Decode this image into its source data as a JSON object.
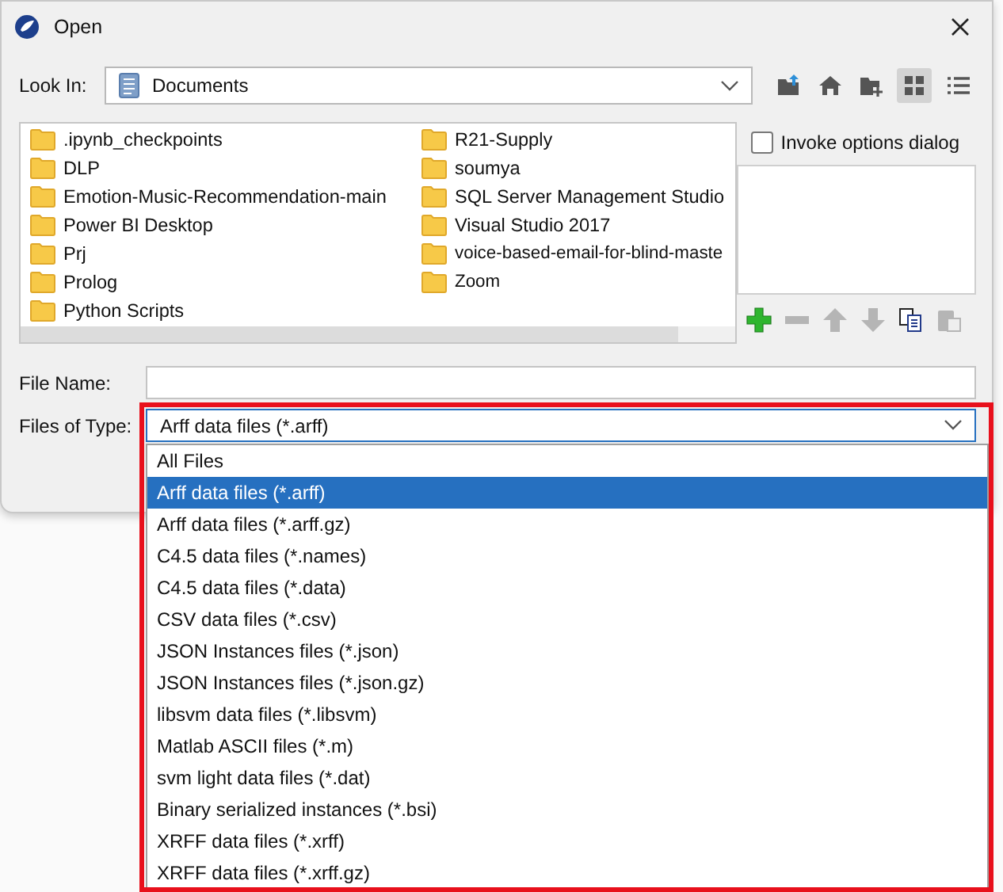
{
  "window": {
    "title": "Open"
  },
  "look_in": {
    "label": "Look In:",
    "value": "Documents"
  },
  "view_modes": [
    {
      "kind": "list",
      "selected": true
    },
    {
      "kind": "details",
      "selected": false
    }
  ],
  "folders": [
    ".ipynb_checkpoints",
    "DLP",
    "Emotion-Music-Recommendation-main",
    "Power BI Desktop",
    "Prj",
    "Prolog",
    "Python Scripts",
    "R21-Supply",
    "soumya",
    "SQL Server Management Studio",
    "Visual Studio 2017",
    "voice-based-email-for-blind-maste",
    "Zoom"
  ],
  "invoke_options": {
    "label": "Invoke options dialog",
    "checked": false
  },
  "option_buttons": [
    {
      "kind": "add",
      "disabled": false
    },
    {
      "kind": "remove",
      "disabled": true
    },
    {
      "kind": "up",
      "disabled": true
    },
    {
      "kind": "down",
      "disabled": true
    },
    {
      "kind": "copy",
      "disabled": false
    },
    {
      "kind": "paste",
      "disabled": true
    }
  ],
  "file_name": {
    "label": "File Name:"
  },
  "files_of_type": {
    "label": "Files of Type:",
    "value": "Arff data files (*.arff)",
    "expanded": true,
    "options": [
      {
        "label": "All Files",
        "selected": false
      },
      {
        "label": "Arff data files (*.arff)",
        "selected": true
      },
      {
        "label": "Arff data files (*.arff.gz)",
        "selected": false
      },
      {
        "label": "C4.5 data files (*.names)",
        "selected": false
      },
      {
        "label": "C4.5 data files (*.data)",
        "selected": false
      },
      {
        "label": "CSV data files (*.csv)",
        "selected": false
      },
      {
        "label": "JSON Instances files (*.json)",
        "selected": false
      },
      {
        "label": "JSON Instances files (*.json.gz)",
        "selected": false
      },
      {
        "label": "libsvm data files (*.libsvm)",
        "selected": false
      },
      {
        "label": "Matlab ASCII files (*.m)",
        "selected": false
      },
      {
        "label": "svm light data files (*.dat)",
        "selected": false
      },
      {
        "label": "Binary serialized instances (*.bsi)",
        "selected": false
      },
      {
        "label": "XRFF data files (*.xrff)",
        "selected": false
      },
      {
        "label": "XRFF data files (*.xrff.gz)",
        "selected": false
      }
    ]
  }
}
